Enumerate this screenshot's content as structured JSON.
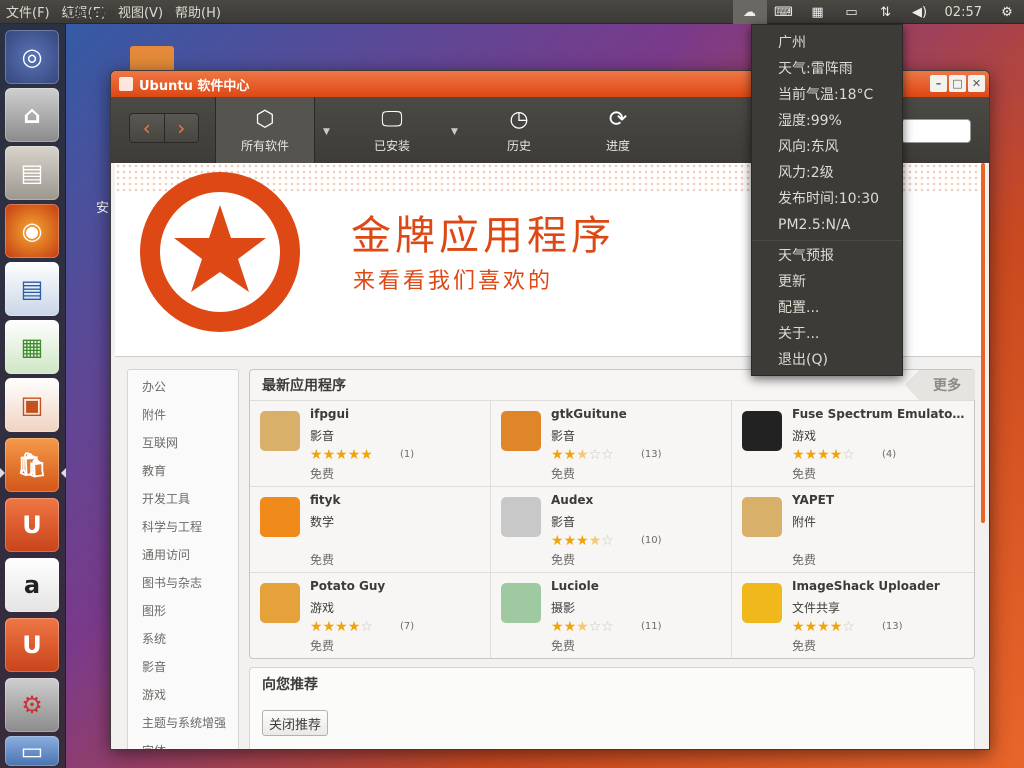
{
  "top_panel": {
    "app_name": "Ubuntu",
    "menus": [
      "文件(F)",
      "编辑(E)",
      "视图(V)",
      "帮助(H)"
    ],
    "clock": "02:57"
  },
  "desktop": {
    "text": "安"
  },
  "window": {
    "title": "Ubuntu 软件中心",
    "toolbar": {
      "all_software": "所有软件",
      "installed": "已安装",
      "history": "历史",
      "progress": "进度"
    },
    "banner": {
      "title": "金牌应用程序",
      "subtitle": "来看看我们喜欢的"
    },
    "sidebar": [
      "办公",
      "附件",
      "互联网",
      "教育",
      "开发工具",
      "科学与工程",
      "通用访问",
      "图书与杂志",
      "图形",
      "系统",
      "影音",
      "游戏",
      "主题与系统增强",
      "字体"
    ],
    "new_apps": {
      "title": "最新应用程序",
      "more": "更多",
      "apps": [
        {
          "name": "ifpgui",
          "category": "影音",
          "rating": 5,
          "count": "(1)",
          "price": "免费",
          "color": "#d8b06a"
        },
        {
          "name": "gtkGuitune",
          "category": "影音",
          "rating": 2.5,
          "count": "(13)",
          "price": "免费",
          "color": "#e0862a"
        },
        {
          "name": "Fuse Spectrum Emulator (G...",
          "category": "游戏",
          "rating": 4,
          "count": "(4)",
          "price": "免费",
          "color": "#222222"
        },
        {
          "name": "fityk",
          "category": "数学",
          "rating": 0,
          "count": "",
          "price": "免费",
          "color": "#f08a1a"
        },
        {
          "name": "Audex",
          "category": "影音",
          "rating": 3.5,
          "count": "(10)",
          "price": "免费",
          "color": "#c8c8c8"
        },
        {
          "name": "YAPET",
          "category": "附件",
          "rating": 0,
          "count": "",
          "price": "免费",
          "color": "#d8b06a"
        },
        {
          "name": "Potato Guy",
          "category": "游戏",
          "rating": 4,
          "count": "(7)",
          "price": "免费",
          "color": "#e6a23a"
        },
        {
          "name": "Luciole",
          "category": "摄影",
          "rating": 2.5,
          "count": "(11)",
          "price": "免费",
          "color": "#9fc9a0"
        },
        {
          "name": "ImageShack Uploader",
          "category": "文件共享",
          "rating": 4,
          "count": "(13)",
          "price": "免费",
          "color": "#f0b81a"
        }
      ]
    },
    "recommend": {
      "title": "向您推荐",
      "button": "关闭推荐"
    }
  },
  "weather_menu": {
    "items": [
      "广州",
      "天气:雷阵雨",
      "当前气温:18°C",
      "湿度:99%",
      "风向:东风",
      "风力:2级",
      "发布时间:10:30",
      "PM2.5:N/A"
    ],
    "actions": [
      "天气预报",
      "更新",
      "配置...",
      "关于...",
      "退出(Q)"
    ]
  },
  "colors": {
    "accent": "#dd4814",
    "panel": "#3c3b37",
    "star": "#f0a30a"
  }
}
